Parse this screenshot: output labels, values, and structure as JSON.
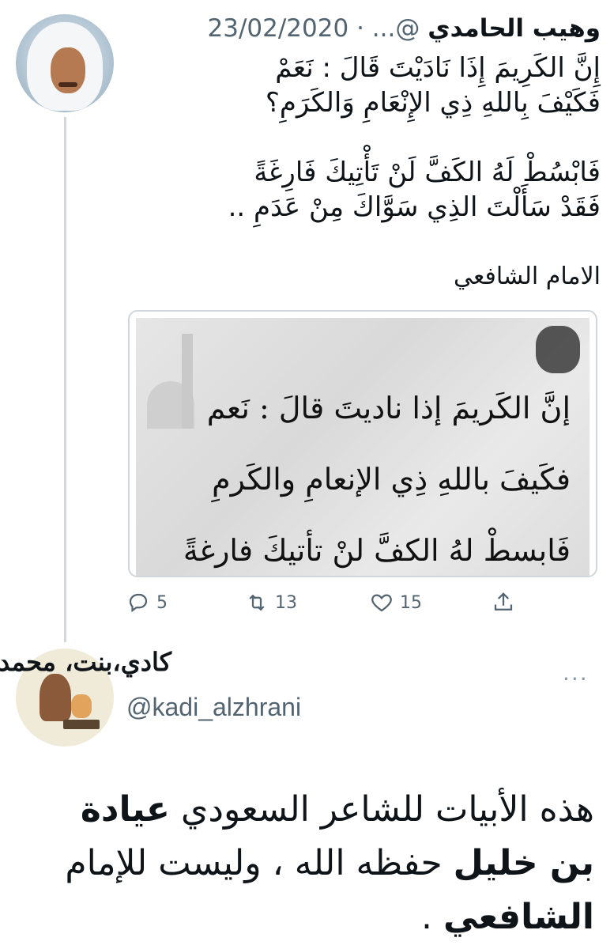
{
  "tweet": {
    "author_name": "وهيب الحامدي",
    "handle": "@...",
    "separator": "·",
    "date": "23/02/2020",
    "lines": [
      "إِنَّ الكَرِيمَ إِذَا نَادَيْتَ قَالَ : نَعَمْ",
      "فَكَيْفَ بِاللهِ ذِي الإِنْعَامِ وَالكَرَمِ؟",
      "فَابْسُطْ لَهُ الكَفَّ لَنْ تَأْتِيكَ فَارِغَةً",
      "فَقَدْ سَأَلْتَ الذِي سَوَّاكَ مِنْ عَدَمِ ..",
      "الامام الشافعي"
    ],
    "media_text": [
      "إنَّ الكَريمَ إذا ناديتَ قالَ : نَعم",
      "فكَيفَ باللهِ ذِي الإنعامِ والكَرمِ",
      "فَابسطْ لهُ الكفَّ لنْ تأتيكَ فارغةً"
    ],
    "actions": {
      "replies": "5",
      "retweets": "13",
      "likes": "15"
    }
  },
  "reply": {
    "author_name": "كادي،بنت، محمد",
    "handle": "@kadi_alzhrani",
    "more": "···",
    "text_parts": [
      "هذه الأبيات للشاعر السعودي ",
      "عيادة بن خليل",
      " حفظه الله ، وليست للإمام ",
      "الشافعي",
      " ."
    ]
  },
  "colors": {
    "text": "#0f1419",
    "secondary": "#536471",
    "thread_line": "#cfd9de"
  }
}
